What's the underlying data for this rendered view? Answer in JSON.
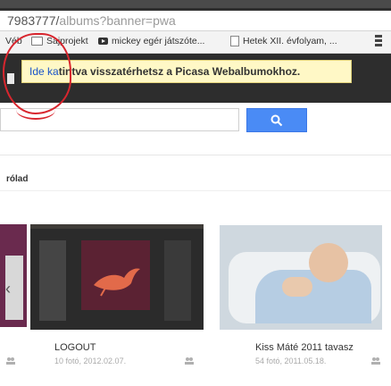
{
  "browser": {
    "url_prefix": "7983777/",
    "url_rest": "albums?banner=pwa"
  },
  "bookmarks": [
    {
      "label": "Véb",
      "icon": "none"
    },
    {
      "label": "Sajprojekt",
      "icon": "folder-icon"
    },
    {
      "label": "mickey egér játszóte...",
      "icon": "youtube-icon"
    },
    {
      "label": "Hetek XII. évfolyam, ...",
      "icon": "page-icon"
    }
  ],
  "notice": {
    "link": "Ide ka",
    "text": "tintva visszatérhetsz a Picasa Webalbumokhoz."
  },
  "section": {
    "label": "rólad"
  },
  "albums": [
    {
      "title": "LOGOUT",
      "meta": "10 fotó, 2012.02.07."
    },
    {
      "title": "Kiss Máté 2011 tavasz",
      "meta": "54 fotó, 2011.05.18."
    }
  ],
  "colors": {
    "annotation": "#d8262e",
    "search_button": "#4a8bf5",
    "notice_bg": "#fff8c6"
  }
}
